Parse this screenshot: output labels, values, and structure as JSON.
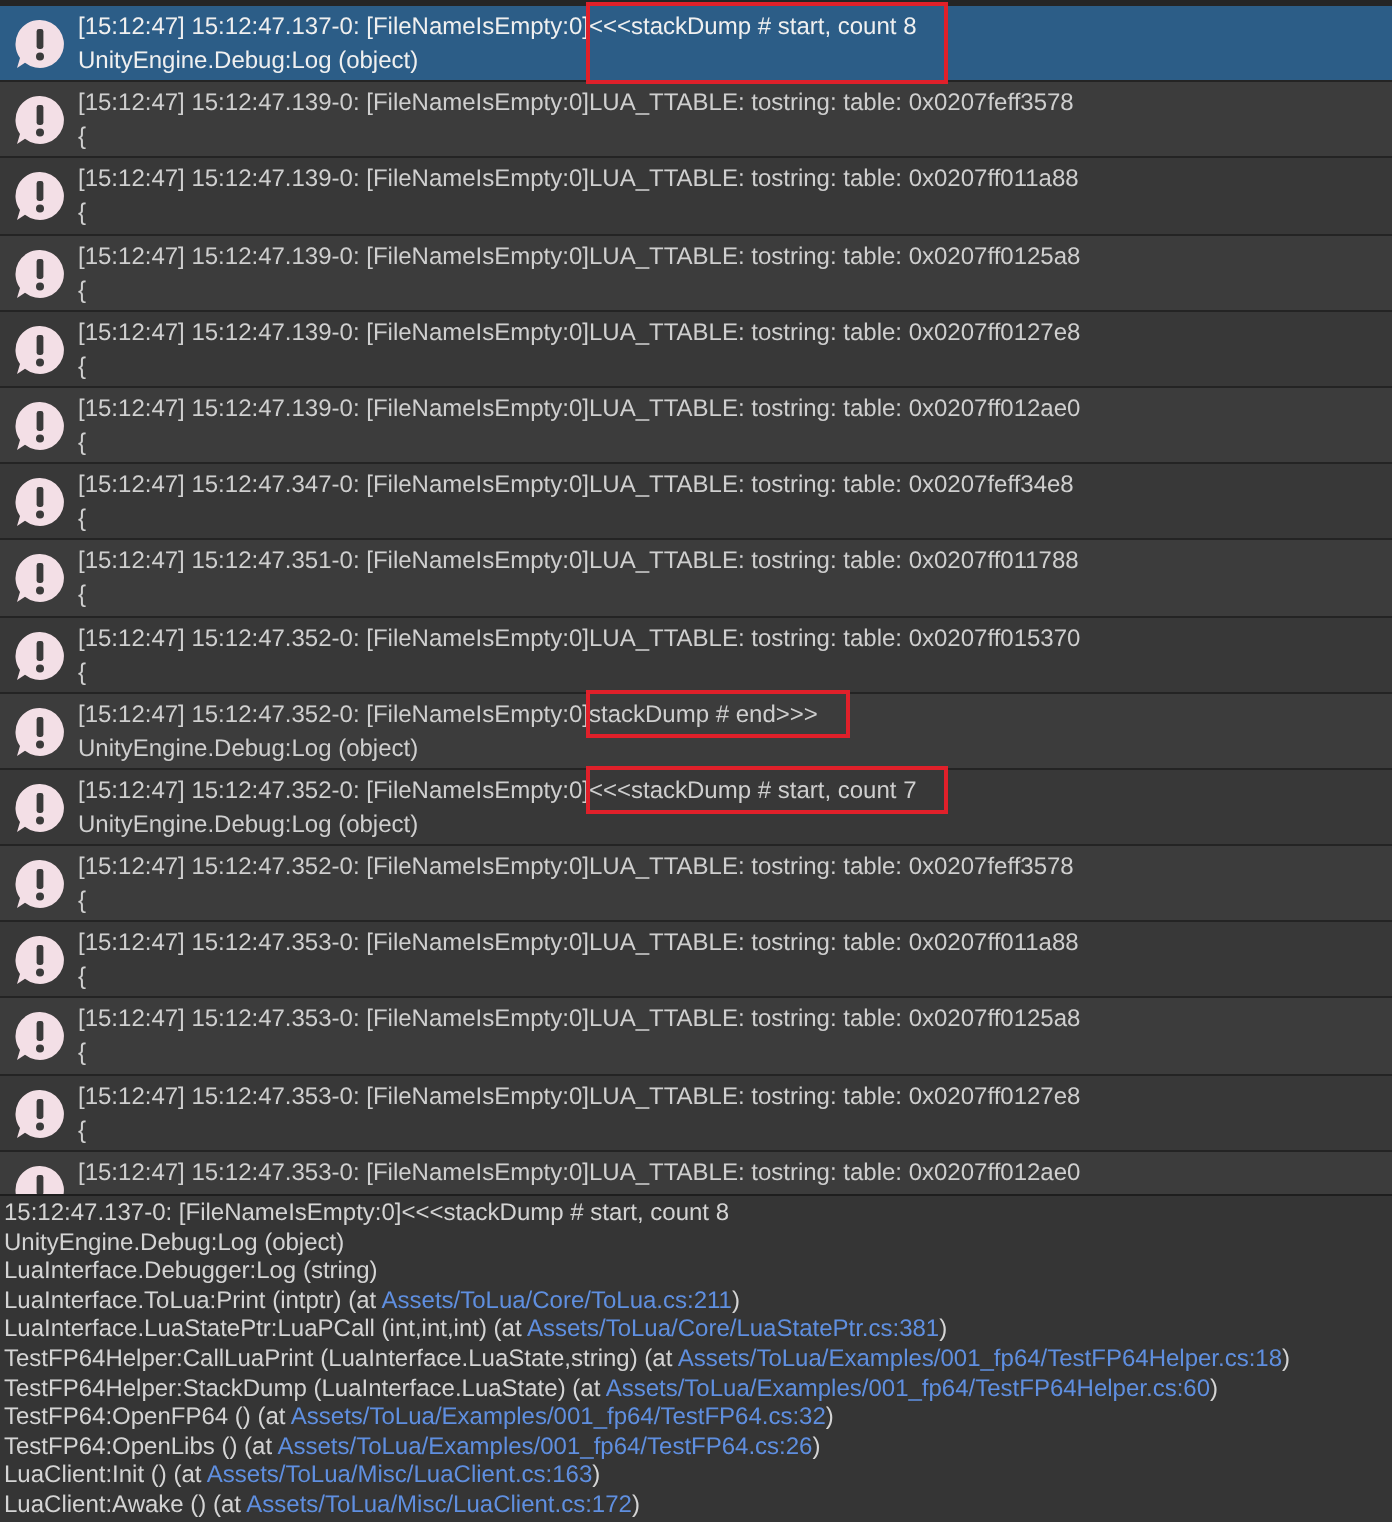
{
  "log_entries": [
    {
      "prefix": "[15:12:47] 15:12:47.137-0: [FileNameIsEmpty:0]",
      "message": "<<<stackDump # start, count 8",
      "detail": "UnityEngine.Debug:Log (object)",
      "selected": true,
      "highlighted": true
    },
    {
      "prefix": "[15:12:47] 15:12:47.139-0: [FileNameIsEmpty:0]",
      "message": "LUA_TTABLE: tostring: table: 0x0207feff3578",
      "detail": "{",
      "selected": false,
      "highlighted": false
    },
    {
      "prefix": "[15:12:47] 15:12:47.139-0: [FileNameIsEmpty:0]",
      "message": "LUA_TTABLE: tostring: table: 0x0207ff011a88",
      "detail": "{",
      "selected": false,
      "highlighted": false
    },
    {
      "prefix": "[15:12:47] 15:12:47.139-0: [FileNameIsEmpty:0]",
      "message": "LUA_TTABLE: tostring: table: 0x0207ff0125a8",
      "detail": "{",
      "selected": false,
      "highlighted": false
    },
    {
      "prefix": "[15:12:47] 15:12:47.139-0: [FileNameIsEmpty:0]",
      "message": "LUA_TTABLE: tostring: table: 0x0207ff0127e8",
      "detail": "{",
      "selected": false,
      "highlighted": false
    },
    {
      "prefix": "[15:12:47] 15:12:47.139-0: [FileNameIsEmpty:0]",
      "message": "LUA_TTABLE: tostring: table: 0x0207ff012ae0",
      "detail": "{",
      "selected": false,
      "highlighted": false
    },
    {
      "prefix": "[15:12:47] 15:12:47.347-0: [FileNameIsEmpty:0]",
      "message": "LUA_TTABLE: tostring: table: 0x0207feff34e8",
      "detail": "{",
      "selected": false,
      "highlighted": false
    },
    {
      "prefix": "[15:12:47] 15:12:47.351-0: [FileNameIsEmpty:0]",
      "message": "LUA_TTABLE: tostring: table: 0x0207ff011788",
      "detail": "{",
      "selected": false,
      "highlighted": false
    },
    {
      "prefix": "[15:12:47] 15:12:47.352-0: [FileNameIsEmpty:0]",
      "message": "LUA_TTABLE: tostring: table: 0x0207ff015370",
      "detail": "{",
      "selected": false,
      "highlighted": false
    },
    {
      "prefix": "[15:12:47] 15:12:47.352-0: [FileNameIsEmpty:0]",
      "message": "stackDump # end>>>",
      "detail": "UnityEngine.Debug:Log (object)",
      "selected": false,
      "highlighted": true
    },
    {
      "prefix": "[15:12:47] 15:12:47.352-0: [FileNameIsEmpty:0]",
      "message": "<<<stackDump # start, count 7",
      "detail": "UnityEngine.Debug:Log (object)",
      "selected": false,
      "highlighted": true
    },
    {
      "prefix": "[15:12:47] 15:12:47.352-0: [FileNameIsEmpty:0]",
      "message": "LUA_TTABLE: tostring: table: 0x0207feff3578",
      "detail": "{",
      "selected": false,
      "highlighted": false
    },
    {
      "prefix": "[15:12:47] 15:12:47.353-0: [FileNameIsEmpty:0]",
      "message": "LUA_TTABLE: tostring: table: 0x0207ff011a88",
      "detail": "{",
      "selected": false,
      "highlighted": false
    },
    {
      "prefix": "[15:12:47] 15:12:47.353-0: [FileNameIsEmpty:0]",
      "message": "LUA_TTABLE: tostring: table: 0x0207ff0125a8",
      "detail": "{",
      "selected": false,
      "highlighted": false
    },
    {
      "prefix": "[15:12:47] 15:12:47.353-0: [FileNameIsEmpty:0]",
      "message": "LUA_TTABLE: tostring: table: 0x0207ff0127e8",
      "detail": "{",
      "selected": false,
      "highlighted": false
    },
    {
      "prefix": "[15:12:47] 15:12:47.353-0: [FileNameIsEmpty:0]",
      "message": "LUA_TTABLE: tostring: table: 0x0207ff012ae0",
      "selected": false,
      "highlighted": false
    }
  ],
  "detail_pane": {
    "lines": [
      {
        "text": "15:12:47.137-0: [FileNameIsEmpty:0]<<<stackDump # start, count 8"
      },
      {
        "text": "UnityEngine.Debug:Log (object)"
      },
      {
        "text": "LuaInterface.Debugger:Log (string)"
      },
      {
        "text": "LuaInterface.ToLua:Print (intptr) (at ",
        "link": "Assets/ToLua/Core/ToLua.cs:211",
        "after": ")"
      },
      {
        "text": "LuaInterface.LuaStatePtr:LuaPCall (int,int,int) (at ",
        "link": "Assets/ToLua/Core/LuaStatePtr.cs:381",
        "after": ")"
      },
      {
        "text": "TestFP64Helper:CallLuaPrint (LuaInterface.LuaState,string) (at ",
        "link": "Assets/ToLua/Examples/001_fp64/TestFP64Helper.cs:18",
        "after": ")"
      },
      {
        "text": "TestFP64Helper:StackDump (LuaInterface.LuaState) (at ",
        "link": "Assets/ToLua/Examples/001_fp64/TestFP64Helper.cs:60",
        "after": ")"
      },
      {
        "text": "TestFP64:OpenFP64 () (at ",
        "link": "Assets/ToLua/Examples/001_fp64/TestFP64.cs:32",
        "after": ")"
      },
      {
        "text": "TestFP64:OpenLibs () (at ",
        "link": "Assets/ToLua/Examples/001_fp64/TestFP64.cs:26",
        "after": ")"
      },
      {
        "text": "LuaClient:Init () (at ",
        "link": "Assets/ToLua/Misc/LuaClient.cs:163",
        "after": ")"
      },
      {
        "text": "LuaClient:Awake () (at ",
        "link": "Assets/ToLua/Misc/LuaClient.cs:172",
        "after": ")"
      }
    ]
  }
}
